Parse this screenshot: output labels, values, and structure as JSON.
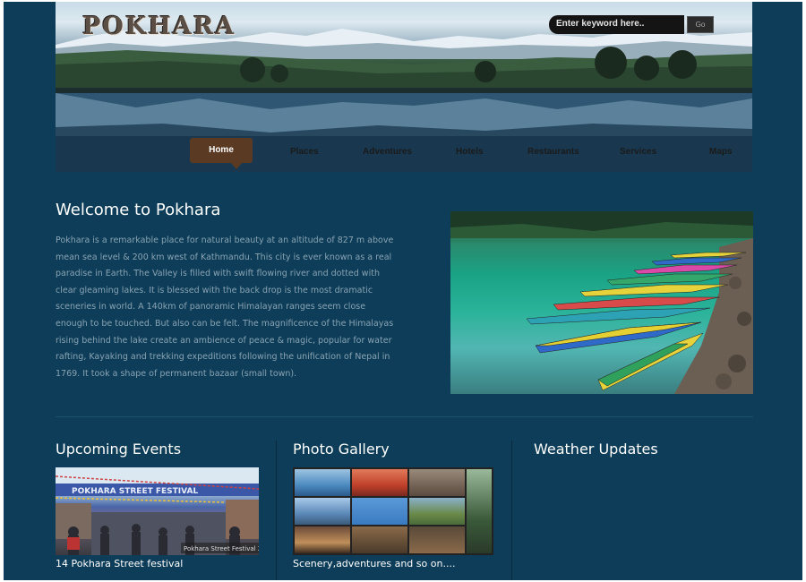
{
  "header": {
    "title": "POKHARA",
    "search": {
      "placeholder": "Enter keyword here..",
      "button_label": "Go"
    },
    "nav": [
      {
        "label": "Home"
      },
      {
        "label": "Places"
      },
      {
        "label": "Adventures"
      },
      {
        "label": "Hotels"
      },
      {
        "label": "Restaurants"
      },
      {
        "label": "Services"
      },
      {
        "label": "Maps"
      }
    ]
  },
  "welcome": {
    "title": "Welcome to Pokhara",
    "body": "Pokhara is a remarkable place for natural beauty at an altitude of 827 m above mean sea level & 200 km west of Kathmandu. This city is ever known as a real paradise in Earth. The Valley is filled with swift flowing river and dotted with clear gleaming lakes. It is blessed with the back drop is the most dramatic sceneries in world. A 140km of panoramic Himalayan ranges seem close enough to be touched. But also can be felt. The magnificence of the Himalayas rising behind the lake create an ambience of peace & magic, popular for water rafting, Kayaking and trekking expeditions following the unification of Nepal in 1769. It took a shape of permanent bazaar (small town)."
  },
  "columns": {
    "events": {
      "title": "Upcoming Events",
      "caption": "14 Pokhara Street festival",
      "banner_text": "Pokhara Street Festival 2012/13"
    },
    "gallery": {
      "title": "Photo Gallery",
      "caption": "Scenery,adventures and so on...."
    },
    "weather": {
      "title": "Weather Updates"
    }
  },
  "colors": {
    "background": "#0d3d58",
    "nav_active": "#5a3a22",
    "body_text": "#8aa3b3"
  }
}
